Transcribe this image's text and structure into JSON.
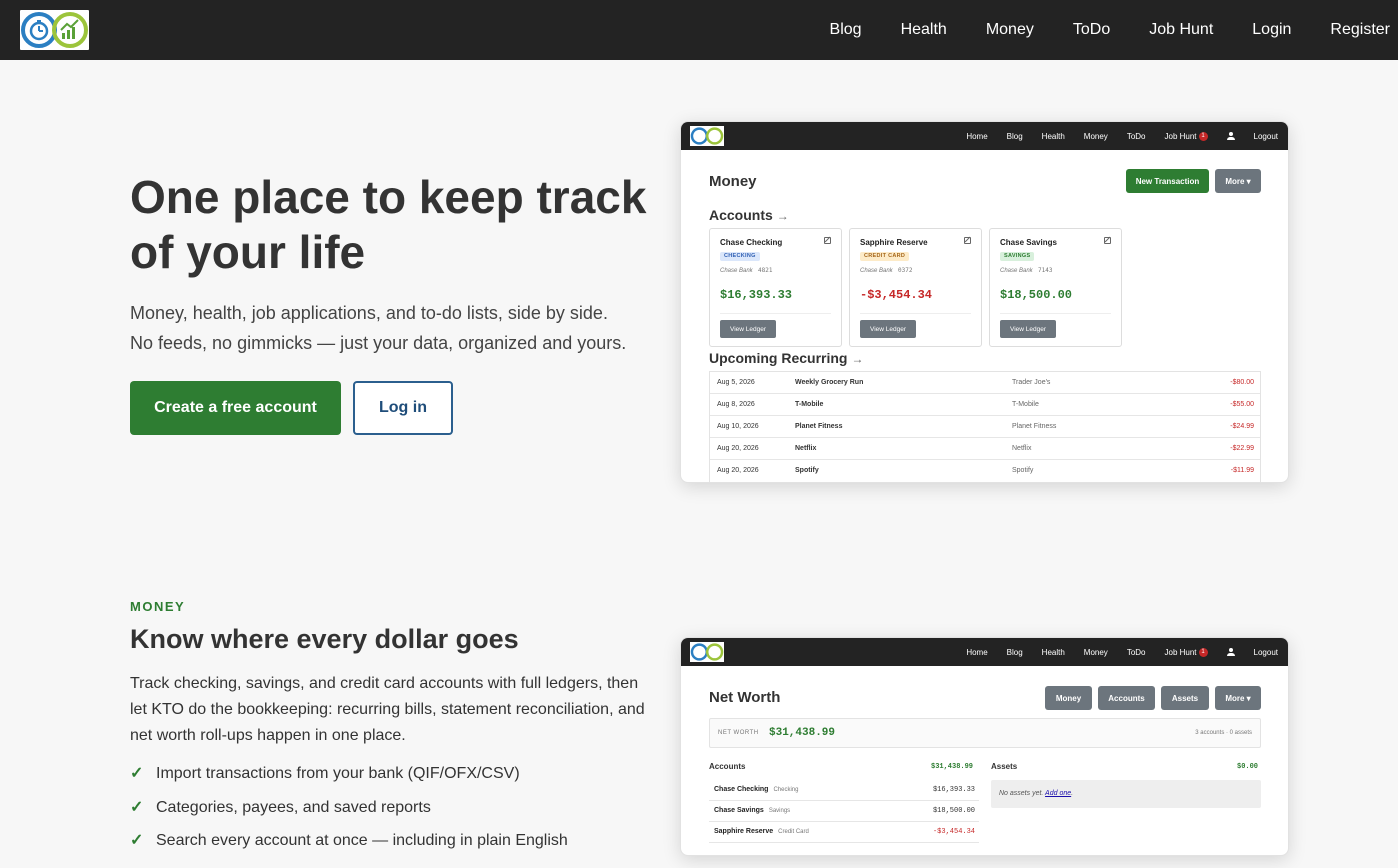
{
  "nav": {
    "logo": "logo-icon",
    "links": [
      "Blog",
      "Health",
      "Money",
      "ToDo",
      "Job Hunt",
      "Login",
      "Register"
    ]
  },
  "hero": {
    "title": "One place to keep track of your life",
    "subtitle_line1": "Money, health, job applications, and to-do lists, side by side.",
    "subtitle_line2": "No feeds, no gimmicks — just your data, organized and yours.",
    "primary_button": "Create a free account",
    "secondary_button": "Log in"
  },
  "money_section": {
    "eyebrow": "MONEY",
    "title": "Know where every dollar goes",
    "description": "Track checking, savings, and credit card accounts with full ledgers, then let KTO do the bookkeeping: recurring bills, statement reconciliation, and net worth roll-ups happen in one place.",
    "features": [
      "Import transactions from your bank (QIF/OFX/CSV)",
      "Categories, payees, and saved reports",
      "Search every account at once — including in plain English"
    ],
    "check_icon": "✓"
  },
  "mini_nav": {
    "links": [
      "Home",
      "Blog",
      "Health",
      "Money",
      "ToDo",
      "Job Hunt"
    ],
    "job_hunt_badge": "1",
    "logout": "Logout"
  },
  "preview_money": {
    "title": "Money",
    "new_transaction": "New Transaction",
    "more": "More ▾",
    "accounts_heading": "Accounts",
    "accounts_arrow": "→",
    "accounts": [
      {
        "name": "Chase Checking",
        "type": "CHECKING",
        "bank": "Chase Bank",
        "last4": "4821",
        "balance": "$16,393.33",
        "view": "View Ledger",
        "tag_bg": "#dbe7fb",
        "tag_fg": "#2f5fb3",
        "balance_color": "#2e7d32"
      },
      {
        "name": "Sapphire Reserve",
        "type": "CREDIT CARD",
        "bank": "Chase Bank",
        "last4": "0372",
        "balance": "-$3,454.34",
        "view": "View Ledger",
        "tag_bg": "#fdebc8",
        "tag_fg": "#a5661a",
        "balance_color": "#c62828"
      },
      {
        "name": "Chase Savings",
        "type": "SAVINGS",
        "bank": "Chase Bank",
        "last4": "7143",
        "balance": "$18,500.00",
        "view": "View Ledger",
        "tag_bg": "#d8f0dc",
        "tag_fg": "#2e7d32",
        "balance_color": "#2e7d32"
      }
    ],
    "recurring_heading": "Upcoming Recurring",
    "recurring_arrow": "→",
    "recurring": [
      {
        "date": "Aug 5, 2026",
        "name": "Weekly Grocery Run",
        "payee": "Trader Joe's",
        "amount": "-$80.00"
      },
      {
        "date": "Aug 8, 2026",
        "name": "T-Mobile",
        "payee": "T-Mobile",
        "amount": "-$55.00"
      },
      {
        "date": "Aug 10, 2026",
        "name": "Planet Fitness",
        "payee": "Planet Fitness",
        "amount": "-$24.99"
      },
      {
        "date": "Aug 20, 2026",
        "name": "Netflix",
        "payee": "Netflix",
        "amount": "-$22.99"
      },
      {
        "date": "Aug 20, 2026",
        "name": "Spotify",
        "payee": "Spotify",
        "amount": "-$11.99"
      }
    ]
  },
  "preview_networth": {
    "title": "Net Worth",
    "buttons": [
      "Money",
      "Accounts",
      "Assets",
      "More ▾"
    ],
    "nw_label": "NET WORTH",
    "nw_value": "$31,438.99",
    "nw_meta": "3 accounts · 0 assets",
    "accounts_heading": "Accounts",
    "accounts_total": "$31,438.99",
    "assets_heading": "Assets",
    "assets_total": "$0.00",
    "accounts": [
      {
        "name": "Chase Checking",
        "type": "Checking",
        "balance": "$16,393.33",
        "color": "#333333"
      },
      {
        "name": "Chase Savings",
        "type": "Savings",
        "balance": "$18,500.00",
        "color": "#333333"
      },
      {
        "name": "Sapphire Reserve",
        "type": "Credit Card",
        "balance": "-$3,454.34",
        "color": "#c62828"
      }
    ],
    "no_assets": "No assets yet.",
    "add_one": "Add one",
    "add_one_suffix": "."
  },
  "colors": {
    "nav_bg": "#232323",
    "primary_green": "#2e7d32",
    "outline_blue": "#2b5f8e",
    "negative_red": "#c62828"
  }
}
